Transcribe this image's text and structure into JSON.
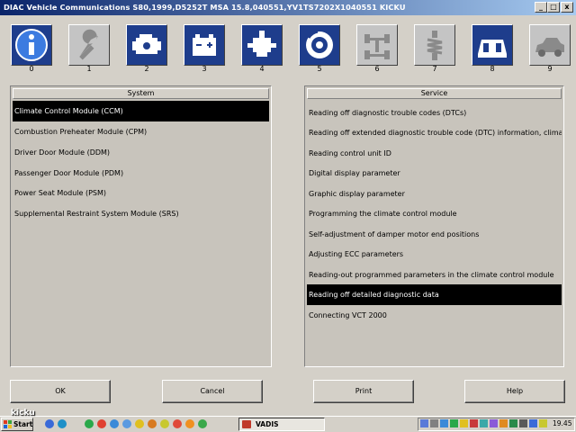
{
  "window": {
    "title": "DIAC  Vehicle Communications S80,1999,D5252T MSA 15.8,040551,YV1TS7202X1040551 KICKU",
    "min_glyph": "_",
    "max_glyph": "□",
    "close_glyph": "x"
  },
  "toolbar": [
    {
      "number": "0",
      "icon": "info-icon",
      "state": "active"
    },
    {
      "number": "1",
      "icon": "wrench-icon",
      "state": "inactive"
    },
    {
      "number": "2",
      "icon": "engine-icon",
      "state": "active"
    },
    {
      "number": "3",
      "icon": "battery-icon",
      "state": "active"
    },
    {
      "number": "4",
      "icon": "gearbox-icon",
      "state": "active"
    },
    {
      "number": "5",
      "icon": "brake-icon",
      "state": "active"
    },
    {
      "number": "6",
      "icon": "steering-icon",
      "state": "inactive"
    },
    {
      "number": "7",
      "icon": "suspension-icon",
      "state": "inactive"
    },
    {
      "number": "8",
      "icon": "interior-icon",
      "state": "active"
    },
    {
      "number": "9",
      "icon": "car-body-icon",
      "state": "inactive"
    }
  ],
  "system_panel": {
    "header": "System",
    "items": [
      "Climate Control Module (CCM)",
      "Combustion Preheater Module (CPM)",
      "Driver Door Module (DDM)",
      "Passenger Door Module (PDM)",
      "Power Seat Module (PSM)",
      "Supplemental Restraint System Module (SRS)"
    ],
    "selected_index": 0
  },
  "service_panel": {
    "header": "Service",
    "items": [
      "Reading off diagnostic trouble codes (DTCs)",
      "Reading off extended diagnostic trouble code (DTC) information, climate c",
      "Reading control unit ID",
      "Digital display parameter",
      "Graphic display parameter",
      "Programming the climate control module",
      "Self-adjustment of damper motor end positions",
      "Adjusting ECC parameters",
      "Reading-out programmed parameters in the climate control module",
      "Reading off detailed diagnostic data",
      "Connecting VCT 2000"
    ],
    "selected_index": 9
  },
  "buttons": {
    "ok": "OK",
    "cancel": "Cancel",
    "print": "Print",
    "help": "Help"
  },
  "taskbar": {
    "start_label": "Start",
    "task_label": "VADIS",
    "clock": "19.45",
    "watermark": "kicku"
  },
  "colors": {
    "title_start": "#0a246a",
    "title_end": "#a6caf0",
    "icon_active_bg": "#1e3d8c",
    "icon_inactive_bg": "#c4c4c4",
    "selection": "#000000"
  }
}
